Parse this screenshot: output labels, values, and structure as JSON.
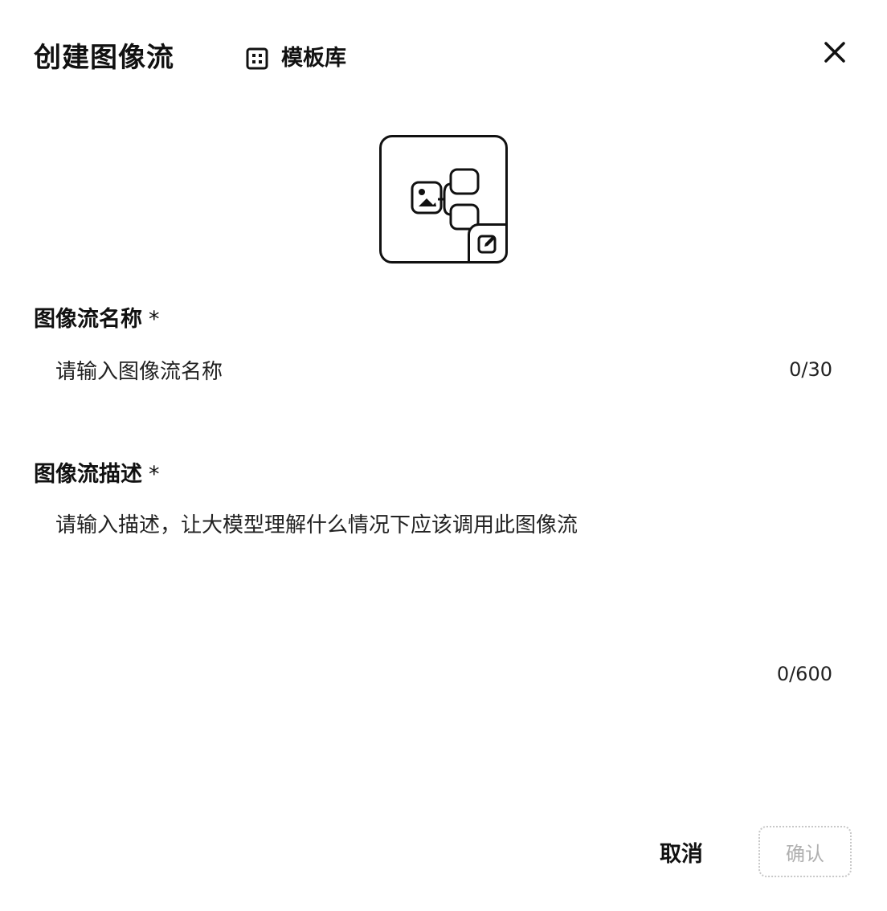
{
  "dialog": {
    "title": "创建图像流",
    "template_link": {
      "icon": "grid-icon",
      "label": "模板库"
    },
    "close_icon": "close-icon"
  },
  "avatar": {
    "icon": "image-flow-icon",
    "edit_icon": "edit-icon"
  },
  "name_field": {
    "label": "图像流名称",
    "required_mark": "*",
    "placeholder": "请输入图像流名称",
    "counter": "0/30"
  },
  "description_field": {
    "label": "图像流描述",
    "required_mark": "*",
    "placeholder": "请输入描述，让大模型理解什么情况下应该调用此图像流",
    "counter": "0/600"
  },
  "footer": {
    "cancel_label": "取消",
    "confirm_label": "确认",
    "confirm_disabled": true
  }
}
